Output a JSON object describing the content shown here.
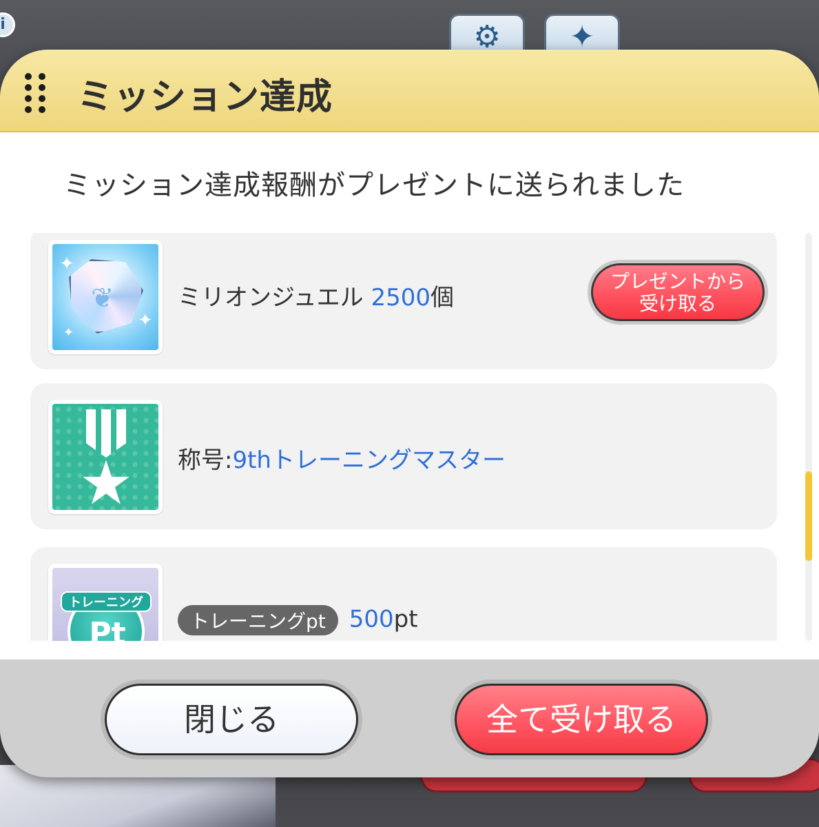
{
  "background": {
    "info_icon": "i",
    "gear_icon": "gear-icon",
    "sparkle_icon": "sparkle-icon"
  },
  "dialog": {
    "title": "ミッション達成",
    "message": "ミッション達成報酬がプレゼントに送られました",
    "rewards": [
      {
        "name": "ミリオンジュエル",
        "amount": "2500",
        "unit": "個",
        "icon": "million-jewel-icon",
        "action_label_line1": "プレゼントから",
        "action_label_line2": "受け取る"
      },
      {
        "name_prefix": "称号:",
        "name_value": "9thトレーニングマスター",
        "icon": "title-medal-icon"
      },
      {
        "tag": "トレーニングpt",
        "amount": "500",
        "unit": "pt",
        "icon": "training-pt-icon",
        "icon_banner": "トレーニング",
        "icon_text": "Pt"
      }
    ],
    "buttons": {
      "close": "閉じる",
      "receive_all": "全て受け取る"
    }
  },
  "colors": {
    "header": "#eed67c",
    "accent_blue": "#2f6fd8",
    "button_red": "#ff5460",
    "scroll_thumb": "#f3c63a"
  }
}
